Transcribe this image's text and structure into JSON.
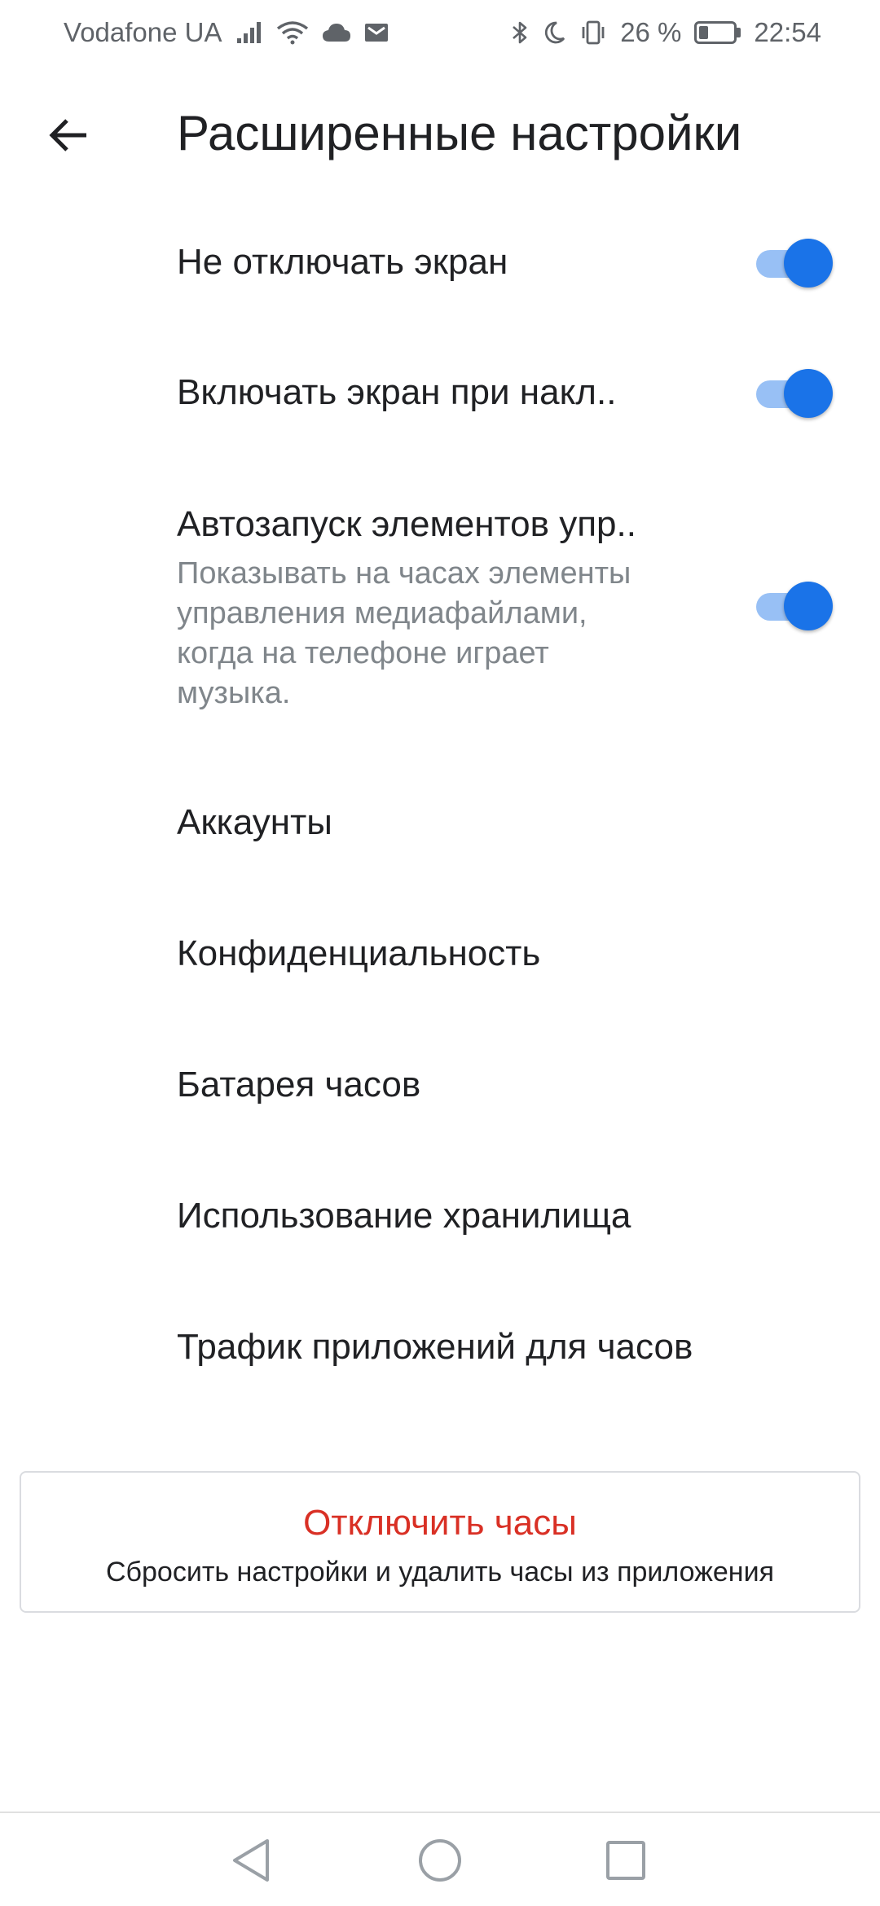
{
  "status_bar": {
    "carrier": "Vodafone UA",
    "battery_percent": "26 %",
    "battery_level": 0.26,
    "time": "22:54",
    "icons": [
      "signal-icon",
      "wifi-icon",
      "cloud-icon",
      "mail-icon",
      "bluetooth-icon",
      "moon-icon",
      "vibrate-icon",
      "battery-icon"
    ]
  },
  "header": {
    "title": "Расширенные настройки"
  },
  "settings": {
    "keep_screen_on": {
      "title": "Не отключать экран",
      "enabled": true
    },
    "tilt_to_wake": {
      "title": "Включать экран при накл..",
      "enabled": true
    },
    "media_controls": {
      "title": "Автозапуск элементов упр..",
      "summary": "Показывать на часах элементы управления медиафайлами, когда на телефоне играет музыка.",
      "enabled": true
    },
    "accounts": {
      "title": "Аккаунты"
    },
    "privacy": {
      "title": "Конфиденциальность"
    },
    "watch_battery": {
      "title": "Батарея часов"
    },
    "storage": {
      "title": "Использование хранилища"
    },
    "app_traffic": {
      "title": "Трафик приложений для часов"
    }
  },
  "disconnect": {
    "title": "Отключить часы",
    "subtitle": "Сбросить настройки и удалить часы из приложения"
  },
  "colors": {
    "accent": "#1a73e8",
    "danger": "#d93025",
    "text_primary": "#202124",
    "text_secondary": "#80868b"
  }
}
